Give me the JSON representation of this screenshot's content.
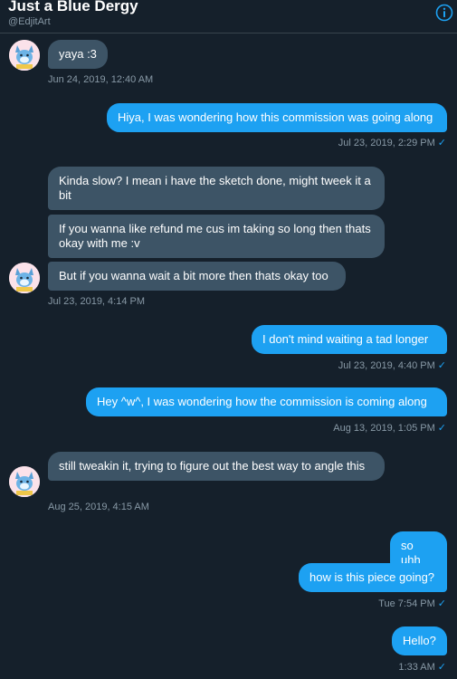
{
  "header": {
    "name": "Just a Blue Dergy",
    "handle": "@EdjitArt"
  },
  "messages": [
    {
      "dir": "in",
      "text": "yaya :3"
    },
    {
      "dir": "out",
      "text": "Hiya, I was wondering how this commission was going along"
    },
    {
      "dir": "in",
      "text": "Kinda slow? I mean i have the sketch done, might tweek it a bit"
    },
    {
      "dir": "in",
      "text": "If you wanna like refund me cus im taking so long then thats okay with me :v"
    },
    {
      "dir": "in",
      "text": "But if you wanna wait a bit more then thats okay too"
    },
    {
      "dir": "out",
      "text": "I don't mind waiting a tad longer"
    },
    {
      "dir": "out",
      "text": "Hey ^w^, I was wondering how the commission is coming along"
    },
    {
      "dir": "in",
      "text": "still tweakin it, trying to figure out the best way to angle this"
    },
    {
      "dir": "out",
      "text": "so uhh"
    },
    {
      "dir": "out",
      "text": "how is this piece going?"
    },
    {
      "dir": "out",
      "text": "Hello?"
    }
  ],
  "timestamps": [
    "Jun 24, 2019, 12:40 AM",
    "Jul 23, 2019, 2:29 PM",
    "Jul 23, 2019, 4:14 PM",
    "Jul 23, 2019, 4:40 PM",
    "Aug 13, 2019, 1:05 PM",
    "Aug 25, 2019, 4:15 AM",
    "Tue 7:54 PM",
    "1:33 AM"
  ],
  "icons": {
    "read_check": "✓",
    "info": "info-icon",
    "avatar": "dragon-avatar"
  },
  "colors": {
    "background": "#15202b",
    "incoming_bubble": "#3d5466",
    "outgoing_bubble": "#1da1f2",
    "meta_text": "#8899a6"
  }
}
